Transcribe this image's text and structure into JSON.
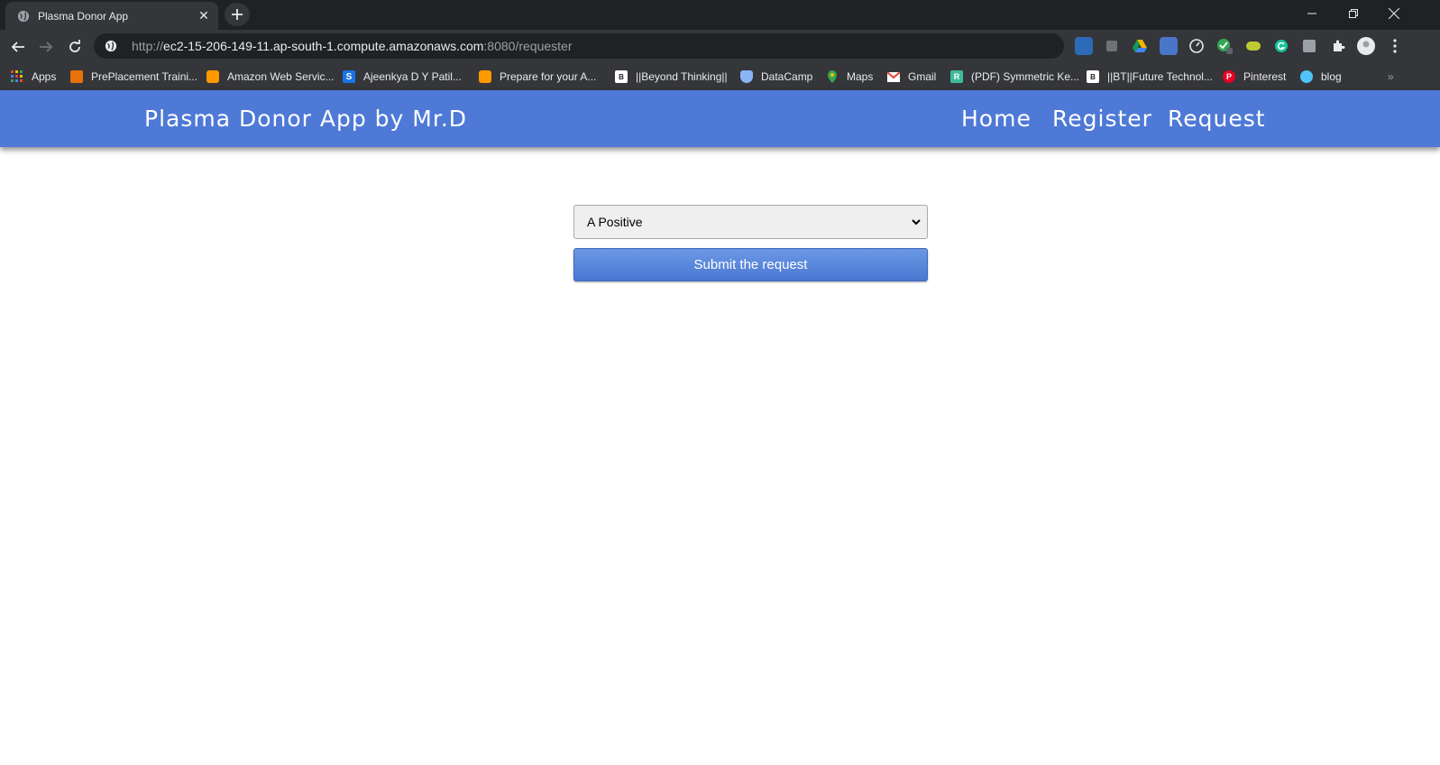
{
  "browser": {
    "tab_title": "Plasma Donor App",
    "url_prefix": "http://",
    "url_host": "ec2-15-206-149-11.ap-south-1.compute.amazonaws.com",
    "url_path": ":8080/requester"
  },
  "bookmarks": [
    {
      "label": "Apps",
      "icon": "apps-grid-icon",
      "color": "#f4b400"
    },
    {
      "label": "PrePlacement Traini...",
      "icon": "preplacement-icon",
      "color": "#e8710a"
    },
    {
      "label": "Amazon Web Servic...",
      "icon": "aws-box-icon",
      "color": "#ff9900"
    },
    {
      "label": "Ajeenkya D Y Patil...",
      "icon": "s-logo-icon",
      "color": "#1a73e8"
    },
    {
      "label": "Prepare for your A...",
      "icon": "aws-box-icon",
      "color": "#ff9900"
    },
    {
      "label": "||Beyond Thinking||",
      "icon": "bt-logo-icon",
      "color": "#ffffff"
    },
    {
      "label": "DataCamp",
      "icon": "datacamp-shield-icon",
      "color": "#8ab4f8"
    },
    {
      "label": "Maps",
      "icon": "maps-pin-icon",
      "color": "#34a853"
    },
    {
      "label": "Gmail",
      "icon": "gmail-icon",
      "color": "#ea4335"
    },
    {
      "label": "(PDF) Symmetric Ke...",
      "icon": "researchgate-icon",
      "color": "#40ba9b"
    },
    {
      "label": "||BT||Future Technol...",
      "icon": "bt-logo-icon",
      "color": "#ffffff"
    },
    {
      "label": "Pinterest",
      "icon": "pinterest-icon",
      "color": "#e60023"
    },
    {
      "label": "blog",
      "icon": "blog-icon",
      "color": "#4fc3f7"
    }
  ],
  "app": {
    "brand": "Plasma Donor App by Mr.D",
    "nav": [
      "Home",
      "Register",
      "Request"
    ],
    "accent_color": "#4e79d6"
  },
  "form": {
    "blood_group_selected": "A Positive",
    "submit_label": "Submit the request"
  }
}
